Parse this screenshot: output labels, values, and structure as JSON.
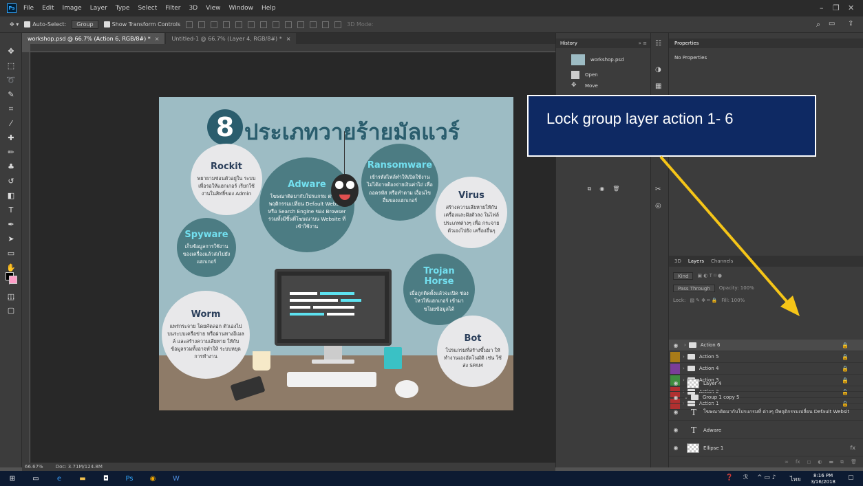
{
  "menubar": {
    "items": [
      "File",
      "Edit",
      "Image",
      "Layer",
      "Type",
      "Select",
      "Filter",
      "3D",
      "View",
      "Window",
      "Help"
    ],
    "logo": "Ps"
  },
  "options": {
    "auto_select": "Auto-Select:",
    "group": "Group",
    "transform": "Show Transform Controls",
    "mode3d": "3D Mode:"
  },
  "tabs": [
    {
      "label": "workshop.psd @ 66.7% (Action 6, RGB/8#) *"
    },
    {
      "label": "Untitled-1 @ 66.7% (Layer 4, RGB/8#) *"
    }
  ],
  "status": {
    "zoom": "66.67%",
    "doc": "Doc: 3.71M/124.8M"
  },
  "artwork": {
    "number": "8",
    "title": "ประเภทวายร้ายมัลแวร์",
    "bubbles": {
      "rockit": {
        "title": "Rockit",
        "body": "พยายามซ่อนตัวอยู่ใน ระบบเพื่อรอให้แฮกเกอร์ เรียกใช้งานในสิทธิ์ของ Admin"
      },
      "adware": {
        "title": "Adware",
        "body": "โฆษณาติดมากับโปรแกรม ต่างๆ มีพฤติกรรมเปลี่ยน Default Website หรือ Search Engine ของ Browser รวมทั้งมีชิ้นที่โฆษณาบน Website ที่เข้าใช้งาน"
      },
      "ransomware": {
        "title": "Ransomware",
        "body": "เข้ารหัสไฟล์ทำให้เปิดใช้งาน ไม่ได้อาจต้องจ่ายเงินค่าไถ่ เพื่อถอดรหัส หรือทำตาม เงื่อนไขอื่นของแฮกเกอร์"
      },
      "virus": {
        "title": "Virus",
        "body": "สร้างความเสียหายให้กับ เครื่องและฝังตัวลง ในไฟล์ประเภทต่างๆ เพื่อ กระจายตัวเองไปยัง เครื่องอื่นๆ"
      },
      "spyware": {
        "title": "Spyware",
        "body": "เก็บข้อมูลการใช้งาน ของเครื่องแล้วส่งไปยัง แฮกเกอร์"
      },
      "trojan": {
        "title": "Trojan Horse",
        "body": "เมื่อถูกติดตั้งแล้วจะเปิด ช่องโหว่ให้แฮกเกอร์ เข้ามาขโมยข้อมูลได้"
      },
      "worm": {
        "title": "Worm",
        "body": "แพร่กระจาย โดยคัดลอก ตัวเองไปบนระบบเครือข่าย หรือผ่านทางอีเมลล์ และสร้างความเสียหาย ให้กับข้อมูลรวมทั้งอาจทำให้ ระบบหยุดการทำงาน"
      },
      "bot": {
        "title": "Bot",
        "body": "โปรแกรมที่สร้างขึ้นมา ให้ทำงานเองอัตโนมัติ เช่น ใช้ส่ง SPAM"
      }
    }
  },
  "callout": {
    "text": "Lock group layer  action 1- 6"
  },
  "history": {
    "tab": "History",
    "snapshot": "workshop.psd",
    "items": [
      "Open",
      "Move"
    ]
  },
  "properties": {
    "tab": "Properties",
    "body": "No Properties"
  },
  "layers_panel": {
    "tabs": [
      "3D",
      "Layers",
      "Channels"
    ],
    "kind": "Kind",
    "blend": "Pass Through",
    "opacity": "Opacity: 100%",
    "lock": "Lock:",
    "fill": "Fill: 100%",
    "layers": [
      {
        "name": "Action 6",
        "color": "#3d57a8",
        "locked": true,
        "selected": true
      },
      {
        "name": "Action 5",
        "color": "#a87b18",
        "locked": true
      },
      {
        "name": "Action 4",
        "color": "#7a3d98",
        "locked": true
      },
      {
        "name": "Action 3",
        "color": "#3f8c3f",
        "locked": true
      },
      {
        "name": "Action 2",
        "color": "#b03030",
        "locked": true
      },
      {
        "name": "Action 1",
        "color": "#b03030",
        "locked": true
      }
    ],
    "layer4": "Layer 4",
    "group_copy": "Group 1 copy 5",
    "text_layer1": "โฆษณาติดมากับโปรแกรมที่  ต่างๆ  มีพฤติกรรมเปลี่ยน Default Websit",
    "text_layer2": "Adware",
    "ellipse": "Ellipse 1"
  },
  "taskbar": {
    "time": "8:16 PM",
    "date": "3/16/2018",
    "lang": "ไทย"
  }
}
